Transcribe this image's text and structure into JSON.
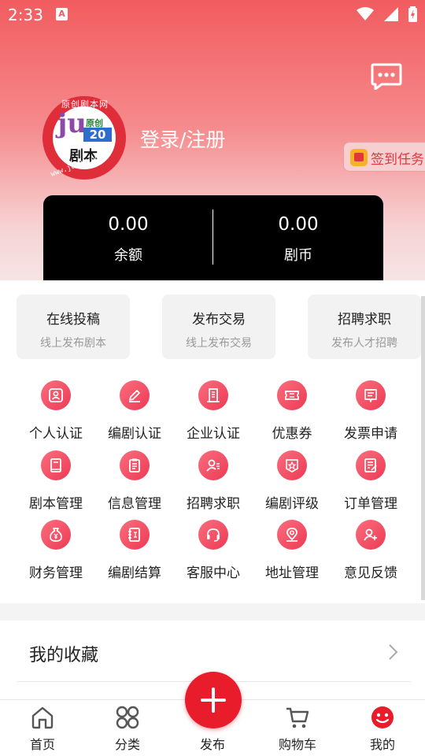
{
  "status_bar": {
    "time": "2:33",
    "notification_glyph": "A"
  },
  "profile": {
    "logo_text_top": "原创剧本网",
    "logo_text_ju": "ju",
    "logo_text_yuanchuang": "原创",
    "logo_text_20": "20",
    "logo_text_juben": "剧本",
    "logo_text_url": "www.ju20.com",
    "login_label": "登录/注册",
    "signin_task_label": "签到任务"
  },
  "balance": {
    "left": {
      "value": "0.00",
      "label": "余额"
    },
    "right": {
      "value": "0.00",
      "label": "剧币"
    }
  },
  "quick_actions": [
    {
      "title": "在线投稿",
      "subtitle": "线上发布剧本"
    },
    {
      "title": "发布交易",
      "subtitle": "线上发布交易"
    },
    {
      "title": "招聘求职",
      "subtitle": "发布人才招聘"
    }
  ],
  "services": [
    {
      "label": "个人认证",
      "icon": "person-id-icon"
    },
    {
      "label": "编剧认证",
      "icon": "pen-icon"
    },
    {
      "label": "企业认证",
      "icon": "building-icon"
    },
    {
      "label": "优惠券",
      "icon": "coupon-icon"
    },
    {
      "label": "发票申请",
      "icon": "invoice-icon"
    },
    {
      "label": "剧本管理",
      "icon": "book-icon"
    },
    {
      "label": "信息管理",
      "icon": "clipboard-icon"
    },
    {
      "label": "招聘求职",
      "icon": "user-list-icon"
    },
    {
      "label": "编剧评级",
      "icon": "star-badge-icon"
    },
    {
      "label": "订单管理",
      "icon": "order-icon"
    },
    {
      "label": "财务管理",
      "icon": "money-bag-icon"
    },
    {
      "label": "编剧结算",
      "icon": "settlement-icon"
    },
    {
      "label": "客服中心",
      "icon": "headset-icon"
    },
    {
      "label": "地址管理",
      "icon": "location-icon"
    },
    {
      "label": "意见反馈",
      "icon": "feedback-icon"
    }
  ],
  "favorites": {
    "title": "我的收藏"
  },
  "tabbar": [
    {
      "label": "首页",
      "icon": "home-icon"
    },
    {
      "label": "分类",
      "icon": "category-icon"
    },
    {
      "label": "发布",
      "icon": "plus-icon"
    },
    {
      "label": "购物车",
      "icon": "cart-icon"
    },
    {
      "label": "我的",
      "icon": "smile-icon"
    }
  ],
  "colors": {
    "accent": "#e81c2b",
    "header_top": "#f25c5f",
    "icon_gradient": "#ec3a55",
    "active_tab": "#e81c2b"
  }
}
